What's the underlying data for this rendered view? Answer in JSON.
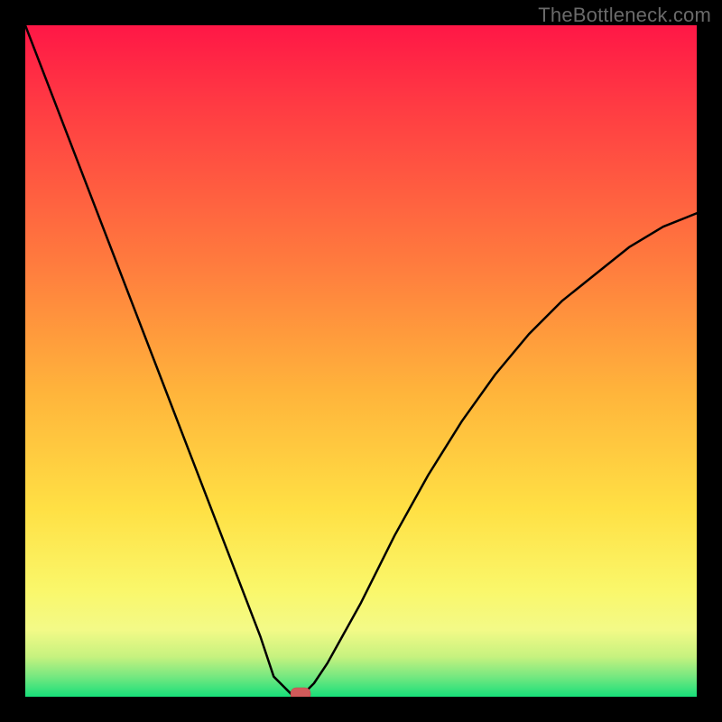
{
  "watermark": "TheBottleneck.com",
  "chart_data": {
    "type": "line",
    "title": "",
    "xlabel": "",
    "ylabel": "",
    "xlim": [
      0,
      100
    ],
    "ylim": [
      0,
      100
    ],
    "x": [
      0,
      5,
      10,
      15,
      20,
      25,
      30,
      35,
      37,
      39,
      40,
      41,
      42,
      43,
      45,
      50,
      55,
      60,
      65,
      70,
      75,
      80,
      85,
      90,
      95,
      100
    ],
    "values": [
      100,
      87,
      74,
      61,
      48,
      35,
      22,
      9,
      3,
      1,
      0,
      0,
      1,
      2,
      5,
      14,
      24,
      33,
      41,
      48,
      54,
      59,
      63,
      67,
      70,
      72
    ],
    "marker": {
      "x": 41,
      "y": 0,
      "color": "#d15a5a"
    },
    "bands": [
      {
        "from": 0,
        "to": 2,
        "color": "#19e07a"
      },
      {
        "from": 2,
        "to": 5,
        "color": "#b6ef79"
      },
      {
        "from": 5,
        "to": 12,
        "color": "#f7f37c"
      },
      {
        "from": 12,
        "to": 100,
        "gradient": true
      }
    ]
  }
}
